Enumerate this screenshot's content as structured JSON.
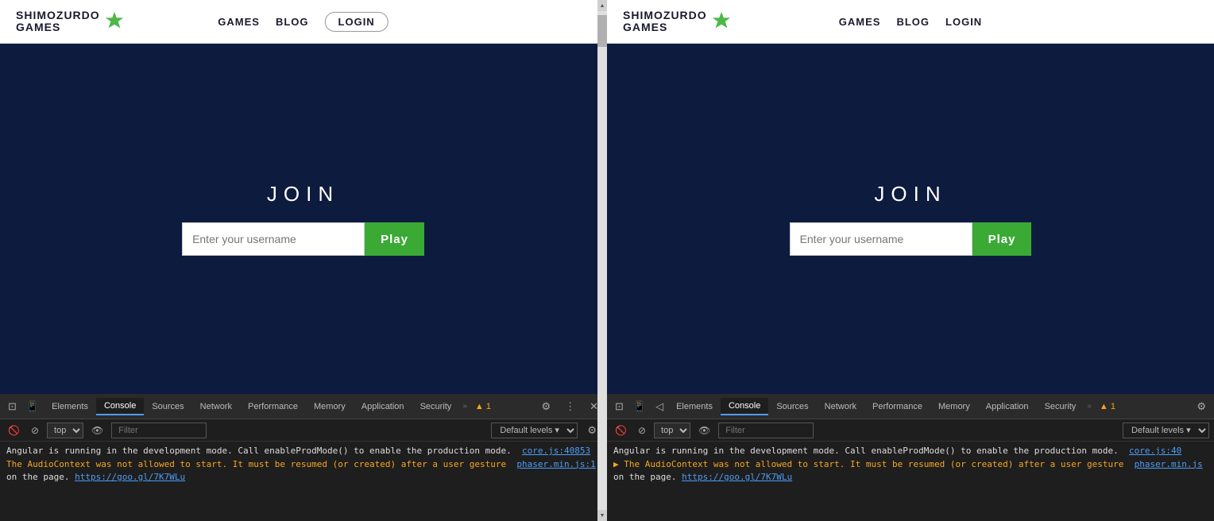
{
  "left": {
    "navbar": {
      "logo_line1": "SHIMOZURDO",
      "logo_line2": "GAMES",
      "nav": {
        "games": "GAMES",
        "blog": "BLOG",
        "login": "LOGIN"
      }
    },
    "game": {
      "title": "JOIN",
      "input_placeholder": "Enter your username",
      "play_button": "Play"
    },
    "devtools": {
      "tabs": [
        "Elements",
        "Console",
        "Sources",
        "Network",
        "Performance",
        "Memory",
        "Application",
        "Security"
      ],
      "active_tab": "Console",
      "overflow": "»",
      "warning_count": "▲ 1",
      "toolbar": {
        "context": "top",
        "filter_placeholder": "Filter",
        "levels": "Default levels ▾"
      },
      "console_lines": [
        "Angular is running in the development mode. Call enableProdMode() to enable the production mode.",
        "The AudioContext was not allowed to start. It must be resumed (or created) after a user gesture",
        "on the page. https://goo.gl/7K7WLu"
      ],
      "links": [
        "core.js:40853",
        "phaser.min.js:1"
      ]
    }
  },
  "right": {
    "navbar": {
      "logo_line1": "SHIMOZURDO",
      "logo_line2": "GAMES",
      "nav": {
        "games": "GAMES",
        "blog": "BLOG",
        "login": "LOGIN"
      }
    },
    "game": {
      "title": "JOIN",
      "input_placeholder": "Enter your username",
      "play_button": "Play"
    },
    "devtools": {
      "tabs": [
        "Elements",
        "Console",
        "Sources",
        "Network",
        "Performance",
        "Memory",
        "Application",
        "Security"
      ],
      "active_tab": "Console",
      "overflow": "»",
      "warning_count": "▲ 1",
      "toolbar": {
        "context": "top",
        "filter_placeholder": "Filter",
        "levels": "Default levels ▾"
      },
      "console_lines": [
        "Angular is running in the development mode. Call enableProdMode() to enable the production mode.",
        "▶ The AudioContext was not allowed to start. It must be resumed (or created) after a user gesture",
        "on the page. https://goo.gl/7K7WLu"
      ],
      "links": [
        "core.js:40",
        "phaser.min.js"
      ]
    }
  },
  "colors": {
    "game_bg": "#0d1b3e",
    "play_btn": "#3aaa35",
    "nav_bg": "#ffffff",
    "devtools_bg": "#1e1e1e",
    "devtools_tab_bar": "#2b2b2b"
  }
}
